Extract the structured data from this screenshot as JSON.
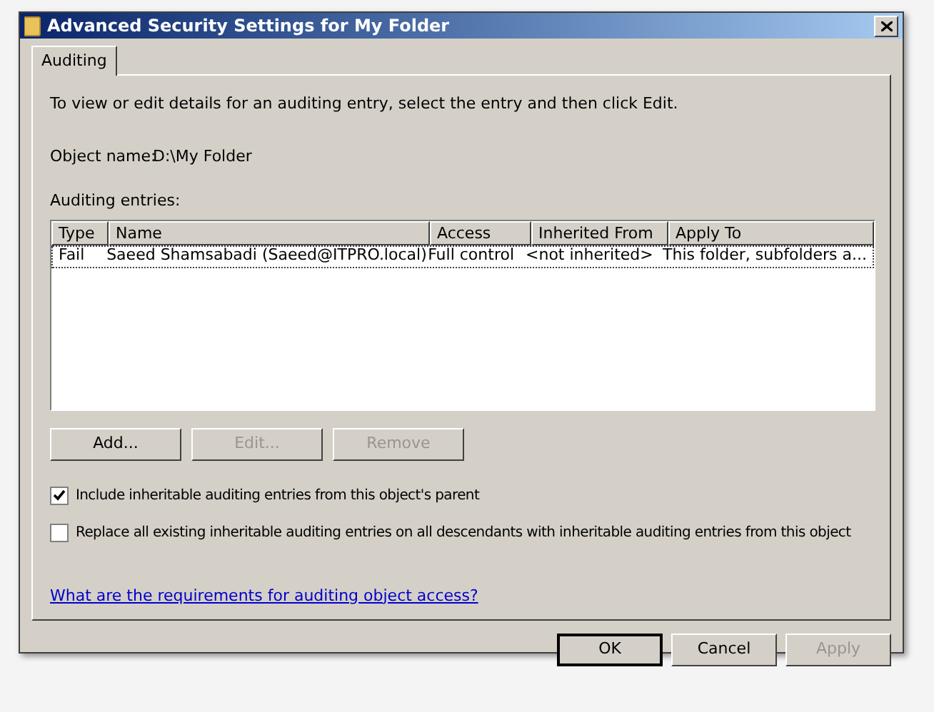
{
  "window": {
    "title": "Advanced Security Settings for My Folder"
  },
  "tabs": [
    {
      "label": "Auditing",
      "selected": true
    }
  ],
  "description": "To view or edit details for an auditing entry, select the entry and then click Edit.",
  "object_name": {
    "label": "Object name:",
    "value": "D:\\My Folder"
  },
  "entries": {
    "label": "Auditing entries:",
    "columns": [
      "Type",
      "Name",
      "Access",
      "Inherited From",
      "Apply To"
    ],
    "rows": [
      {
        "cells": [
          "Fail",
          "Saeed Shamsabadi (Saeed@ITPRO.local)",
          "Full control",
          "<not inherited>",
          "This folder, subfolders a..."
        ],
        "selected": true
      }
    ]
  },
  "buttons": [
    {
      "label": "Add...",
      "disabled": false
    },
    {
      "label": "Edit...",
      "disabled": true
    },
    {
      "label": "Remove",
      "disabled": true
    }
  ],
  "checkboxes": [
    {
      "label": "Include inheritable auditing entries from this object's parent",
      "checked": true
    },
    {
      "label": "Replace all existing inheritable auditing entries on all descendants with inheritable auditing entries from this object",
      "checked": false
    }
  ],
  "link": "What are the requirements for auditing object access?",
  "footer_buttons": [
    {
      "label": "OK",
      "disabled": false,
      "default": true
    },
    {
      "label": "Cancel",
      "disabled": false,
      "default": false
    },
    {
      "label": "Apply",
      "disabled": true,
      "default": false
    }
  ]
}
